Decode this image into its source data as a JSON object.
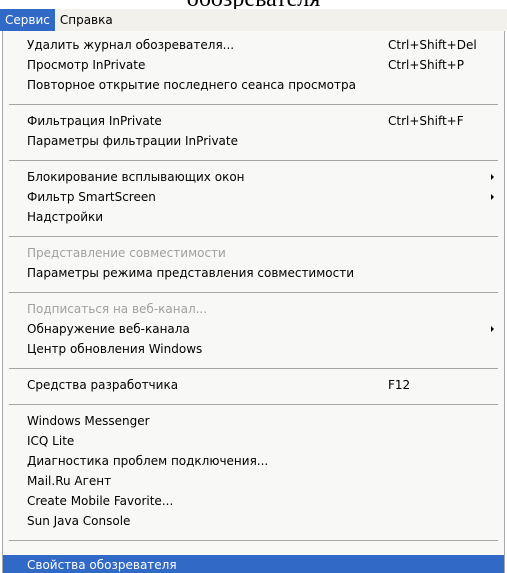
{
  "document": {
    "title_fragment": "обозревателя"
  },
  "menubar": {
    "items": [
      "Сервис",
      "Справка"
    ]
  },
  "menu": {
    "items": [
      {
        "label": "Удалить журнал обозревателя...",
        "shortcut": "Ctrl+Shift+Del"
      },
      {
        "label": "Просмотр InPrivate",
        "shortcut": "Ctrl+Shift+P"
      },
      {
        "label": "Повторное открытие последнего сеанса просмотра",
        "shortcut": ""
      },
      {
        "label": "Фильтрация InPrivate",
        "shortcut": "Ctrl+Shift+F"
      },
      {
        "label": "Параметры фильтрации InPrivate",
        "shortcut": ""
      },
      {
        "label": "Блокирование всплывающих окон",
        "shortcut": "",
        "submenu": true
      },
      {
        "label": "Фильтр SmartScreen",
        "shortcut": "",
        "submenu": true
      },
      {
        "label": "Надстройки",
        "shortcut": ""
      },
      {
        "label": "Представление совместимости",
        "shortcut": "",
        "disabled": true
      },
      {
        "label": "Параметры режима представления совместимости",
        "shortcut": ""
      },
      {
        "label": "Подписаться на веб-канал...",
        "shortcut": "",
        "disabled": true
      },
      {
        "label": "Обнаружение веб-канала",
        "shortcut": "",
        "submenu": true
      },
      {
        "label": "Центр обновления Windows",
        "shortcut": ""
      },
      {
        "label": "Средства разработчика",
        "shortcut": "F12"
      },
      {
        "label": "Windows Messenger",
        "shortcut": ""
      },
      {
        "label": "ICQ Lite",
        "shortcut": ""
      },
      {
        "label": "Диагностика проблем подключения...",
        "shortcut": ""
      },
      {
        "label": "Mail.Ru Агент",
        "shortcut": ""
      },
      {
        "label": "Create Mobile Favorite...",
        "shortcut": ""
      },
      {
        "label": "Sun Java Console",
        "shortcut": ""
      },
      {
        "label": "Свойства обозревателя",
        "shortcut": "",
        "highlighted": true
      }
    ]
  },
  "colors": {
    "menubar_background": "#f3f1ec",
    "menu_background": "#f8f8f6",
    "highlight": "#3169c6",
    "disabled_text": "#a0a0a0",
    "separator": "#a5a5a5"
  }
}
